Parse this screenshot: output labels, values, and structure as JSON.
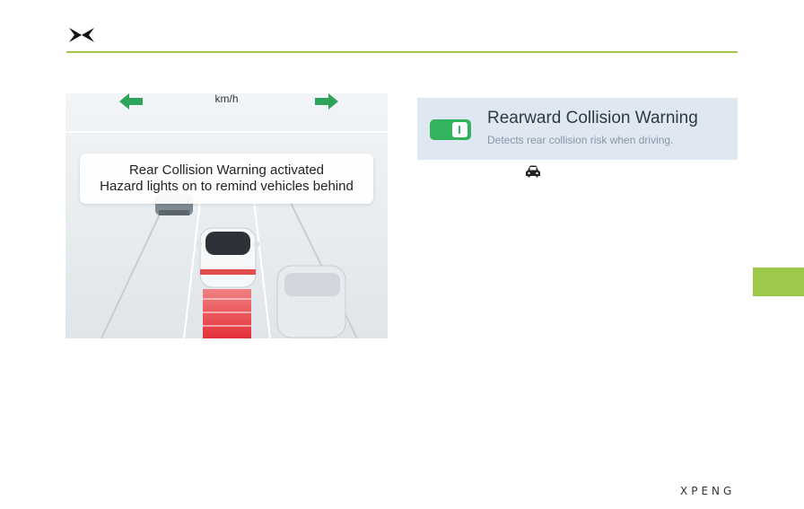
{
  "header": {
    "logo_icon": "xpeng-logo-icon",
    "accent_color": "#9dc84a"
  },
  "illustration": {
    "speed_unit": "km/h",
    "left_arrow_icon": "arrow-left-icon",
    "right_arrow_icon": "arrow-right-icon",
    "arrow_color": "#2ea35a",
    "notice_line1": "Rear Collision Warning activated",
    "notice_line2": "Hazard lights on to remind vehicles behind",
    "warning_zone_color": "#e5303a"
  },
  "settings_card": {
    "title": "Rearward Collision Warning",
    "subtitle": "Detects rear collision risk when driving.",
    "toggle_state": "on",
    "toggle_color": "#34b35e"
  },
  "car_icon": "car-icon",
  "footer": {
    "brand": "XPENG"
  }
}
